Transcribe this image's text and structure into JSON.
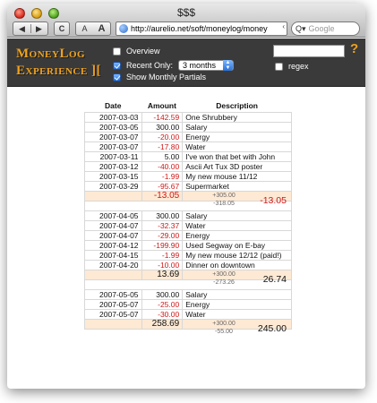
{
  "window": {
    "title": "$$$"
  },
  "toolbar": {
    "back_label": "◀",
    "forward_label": "▶",
    "reload_label": "C",
    "font_small_label": "A",
    "font_big_label": "A",
    "url": "http://aurelio.net/soft/moneylog/money",
    "search_placeholder": "Google"
  },
  "header": {
    "logo_line1": "MoneyLog",
    "logo_line2": "Experience ][",
    "overview_label": "Overview",
    "recent_label": "Recent Only:",
    "recent_value": "3 months",
    "monthly_label": "Show Monthly Partials",
    "regex_label": "regex",
    "help_label": "?",
    "checks": {
      "overview": false,
      "recent": true,
      "monthly": true,
      "regex": false
    }
  },
  "table": {
    "columns": [
      "Date",
      "Amount",
      "Description"
    ],
    "months": [
      {
        "rows": [
          {
            "date": "2007-03-03",
            "amount": "-142.59",
            "desc": "One Shrubbery"
          },
          {
            "date": "2007-03-05",
            "amount": "300.00",
            "desc": "Salary"
          },
          {
            "date": "2007-03-07",
            "amount": "-20.00",
            "desc": "Energy"
          },
          {
            "date": "2007-03-07",
            "amount": "-17.80",
            "desc": "Water"
          },
          {
            "date": "2007-03-11",
            "amount": "5.00",
            "desc": "I've won that bet with John"
          },
          {
            "date": "2007-03-12",
            "amount": "-40.00",
            "desc": "Ascii Art Tux 3D poster"
          },
          {
            "date": "2007-03-15",
            "amount": "-1.99",
            "desc": "My new mouse 11/12"
          },
          {
            "date": "2007-03-29",
            "amount": "-95.67",
            "desc": "Supermarket"
          }
        ],
        "summary": {
          "partial": "-13.05",
          "plus": "+305.00",
          "minus": "-318.05",
          "total": "-13.05"
        }
      },
      {
        "rows": [
          {
            "date": "2007-04-05",
            "amount": "300.00",
            "desc": "Salary"
          },
          {
            "date": "2007-04-07",
            "amount": "-32.37",
            "desc": "Water"
          },
          {
            "date": "2007-04-07",
            "amount": "-29.00",
            "desc": "Energy"
          },
          {
            "date": "2007-04-12",
            "amount": "-199.90",
            "desc": "Used Segway on E-bay"
          },
          {
            "date": "2007-04-15",
            "amount": "-1.99",
            "desc": "My new mouse 12/12 (paid!)"
          },
          {
            "date": "2007-04-20",
            "amount": "-10.00",
            "desc": "Dinner on downtown"
          }
        ],
        "summary": {
          "partial": "13.69",
          "plus": "+300.00",
          "minus": "-273.26",
          "total": "26.74"
        }
      },
      {
        "rows": [
          {
            "date": "2007-05-05",
            "amount": "300.00",
            "desc": "Salary"
          },
          {
            "date": "2007-05-07",
            "amount": "-25.00",
            "desc": "Energy"
          },
          {
            "date": "2007-05-07",
            "amount": "-30.00",
            "desc": "Water"
          }
        ],
        "summary": {
          "partial": "258.69",
          "plus": "+300.00",
          "minus": "-55.00",
          "total": "245.00"
        }
      }
    ]
  }
}
